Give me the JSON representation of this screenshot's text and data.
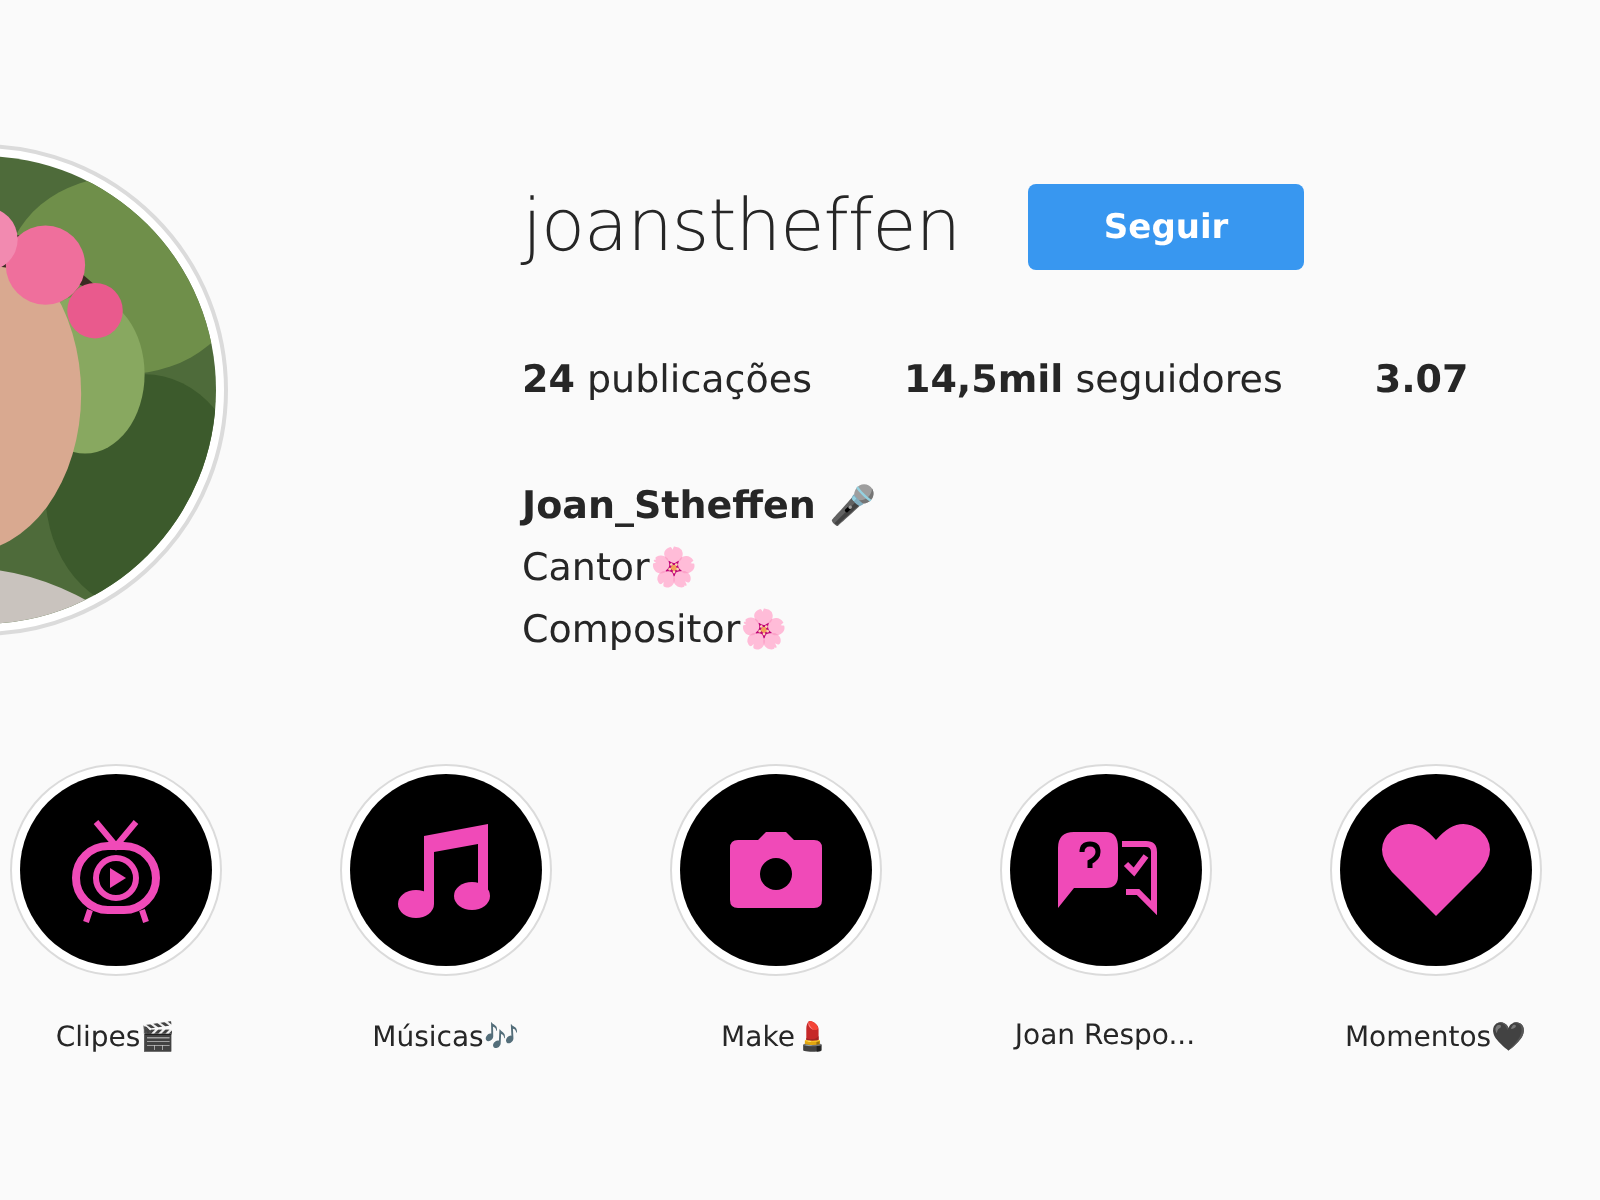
{
  "profile": {
    "username": "joanstheffen",
    "follow_button": "Seguir",
    "stats": [
      {
        "count": "24",
        "label": "publicações"
      },
      {
        "count": "14,5mil",
        "label": "seguidores"
      },
      {
        "count": "3.07"
      }
    ],
    "bio": {
      "name": "Joan_Stheffen 🎤",
      "lines": [
        "Cantor🌸",
        "Compositor🌸"
      ]
    }
  },
  "highlights": [
    {
      "kind": "tv",
      "label": "Clipes🎬"
    },
    {
      "kind": "music",
      "label": "Músicas🎶"
    },
    {
      "kind": "camera",
      "label": "Make💄"
    },
    {
      "kind": "chat",
      "label": "Joan Respo..."
    },
    {
      "kind": "heart",
      "label": "Momentos🖤"
    }
  ]
}
